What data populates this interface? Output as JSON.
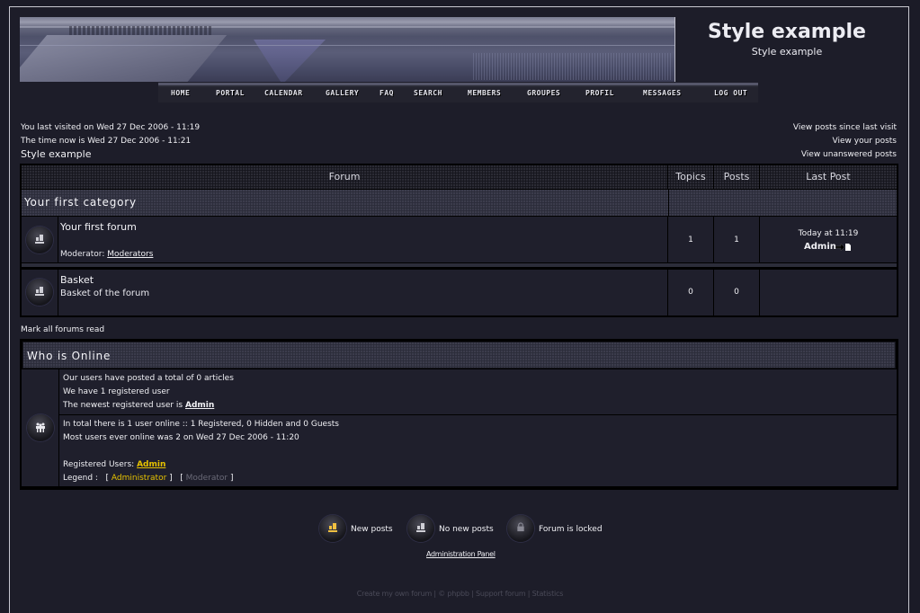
{
  "header": {
    "site_title": "Style example",
    "site_description": "Style example"
  },
  "nav": {
    "items": [
      {
        "label": "HOME"
      },
      {
        "label": "PORTAL"
      },
      {
        "label": "CALENDAR"
      },
      {
        "label": "GALLERY"
      },
      {
        "label": "FAQ"
      },
      {
        "label": "SEARCH"
      },
      {
        "label": "MEMBERS"
      },
      {
        "label": "GROUPES"
      },
      {
        "label": "PROFIL"
      },
      {
        "label": "MESSAGES"
      },
      {
        "label": "LOG OUT"
      }
    ]
  },
  "info": {
    "last_visit": "You last visited on Wed 27 Dec 2006 - 11:19",
    "time_now": "The time now is Wed 27 Dec 2006 - 11:21",
    "page_heading": "Style example",
    "links": [
      "View posts since last visit",
      "View your posts",
      "View unanswered posts"
    ]
  },
  "forum_table": {
    "headers": {
      "forum": "Forum",
      "topics": "Topics",
      "posts": "Posts",
      "last_post": "Last Post"
    },
    "category": "Your first category",
    "forums": [
      {
        "name": "Your first forum",
        "moderator_label": "Moderator:",
        "moderator_link": "Moderators",
        "description": "",
        "topics": "1",
        "posts": "1",
        "last_post_time": "Today at 11:19",
        "last_post_user": "Admin"
      },
      {
        "name": "Basket",
        "description": "Basket of the forum",
        "topics": "0",
        "posts": "0"
      }
    ]
  },
  "mark_read": "Mark all forums read",
  "who_is_online": {
    "title": "Who is Online",
    "stats": {
      "total_posts": "Our users have posted a total of 0 articles",
      "registered_users": "We have 1 registered user",
      "newest_label": "The newest registered user is",
      "newest_user": "Admin"
    },
    "online": {
      "total_online": "In total there is 1 user online :: 1 Registered, 0 Hidden and 0 Guests",
      "record": "Most users ever online was 2 on Wed 27 Dec 2006 - 11:20",
      "registered_label": "Registered Users:",
      "registered_user": "Admin",
      "legend_label": "Legend :",
      "legend_admin": "Administrator",
      "legend_mod": "Moderator"
    },
    "colors": {
      "admin": "#e6c200",
      "moderator": "#6a6a78"
    }
  },
  "legend": {
    "new_posts": "New posts",
    "no_new_posts": "No new posts",
    "locked": "Forum is locked"
  },
  "admin_panel": "Administration Panel",
  "footer": {
    "links": [
      "Create my own forum",
      "© phpbb",
      "Support forum",
      "Statistics"
    ],
    "separator": " | "
  }
}
